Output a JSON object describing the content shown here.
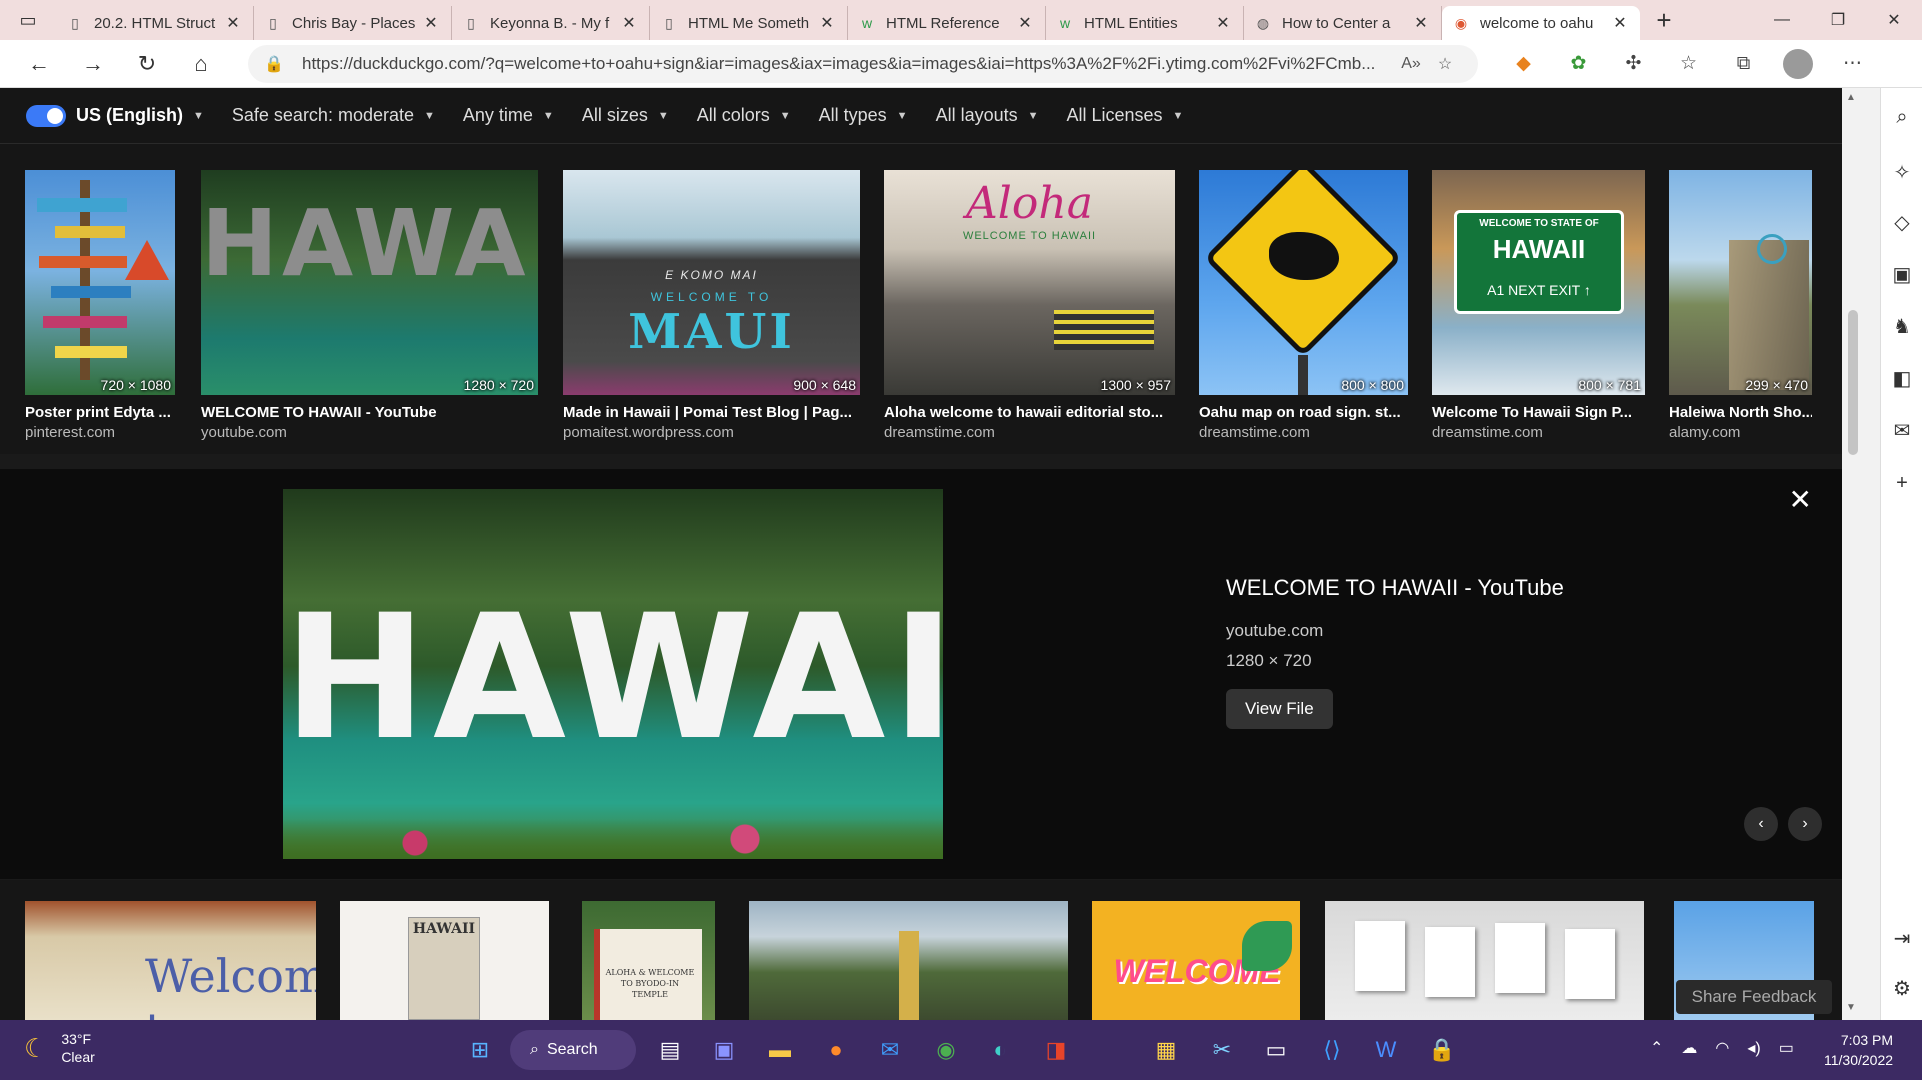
{
  "browser": {
    "tabs": [
      {
        "title": "20.2. HTML Struct",
        "icon": "page-icon"
      },
      {
        "title": "Chris Bay - Places",
        "icon": "page-icon"
      },
      {
        "title": "Keyonna B. - My f",
        "icon": "page-icon"
      },
      {
        "title": "HTML Me Someth",
        "icon": "page-icon"
      },
      {
        "title": "HTML Reference",
        "icon": "w3schools-icon"
      },
      {
        "title": "HTML Entities",
        "icon": "w3schools-icon"
      },
      {
        "title": "How to Center a",
        "icon": "wb-icon"
      },
      {
        "title": "welcome to oahu",
        "icon": "duckduckgo-icon",
        "active": true
      }
    ],
    "url": "https://duckduckgo.com/?q=welcome+to+oahu+sign&iar=images&iax=images&ia=images&iai=https%3A%2F%2Fi.ytimg.com%2Fvi%2FCmb..."
  },
  "filters": {
    "region": "US (English)",
    "items": [
      "Safe search: moderate",
      "Any time",
      "All sizes",
      "All colors",
      "All types",
      "All layouts",
      "All Licenses"
    ]
  },
  "results": [
    {
      "title": "Poster print Edyta ...",
      "source": "pinterest.com",
      "dims": "720 × 1080"
    },
    {
      "title": "WELCOME TO HAWAII - YouTube",
      "source": "youtube.com",
      "dims": "1280 × 720"
    },
    {
      "title": "Made in Hawaii | Pomai Test Blog | Pag...",
      "source": "pomaitest.wordpress.com",
      "dims": "900 × 648"
    },
    {
      "title": "Aloha welcome to hawaii editorial sto...",
      "source": "dreamstime.com",
      "dims": "1300 × 957"
    },
    {
      "title": "Oahu map on road sign. st...",
      "source": "dreamstime.com",
      "dims": "800 × 800"
    },
    {
      "title": "Welcome To Hawaii Sign P...",
      "source": "dreamstime.com",
      "dims": "800 × 781"
    },
    {
      "title": "Haleiwa North Sho...",
      "source": "alamy.com",
      "dims": "299 × 470"
    }
  ],
  "thumb_text": {
    "hawaii": "HAWAII",
    "maui_top": "E KOMO MAI",
    "maui_mid": "WELCOME TO",
    "maui_big": "MAUI",
    "aloha": "Aloha",
    "aloha_sub": "WELCOME TO HAWAII",
    "sign_top": "WELCOME TO STATE OF",
    "sign_big": "HAWAII",
    "sign_exit": "A1 NEXT EXIT ↑",
    "welcome_board": "Welcome t",
    "welcome_yellow": "WELCOME",
    "book_title": "HAWAII",
    "temple_text": "ALOHA & WELCOME TO BYODO-IN TEMPLE"
  },
  "detail": {
    "title": "WELCOME TO HAWAII - YouTube",
    "source": "youtube.com",
    "size": "1280 × 720",
    "button": "View File",
    "image_text": "HAWAII"
  },
  "share_feedback": "Share Feedback",
  "taskbar": {
    "weather_temp": "33°F",
    "weather_desc": "Clear",
    "search_label": "Search",
    "time": "7:03 PM",
    "date": "11/30/2022"
  }
}
